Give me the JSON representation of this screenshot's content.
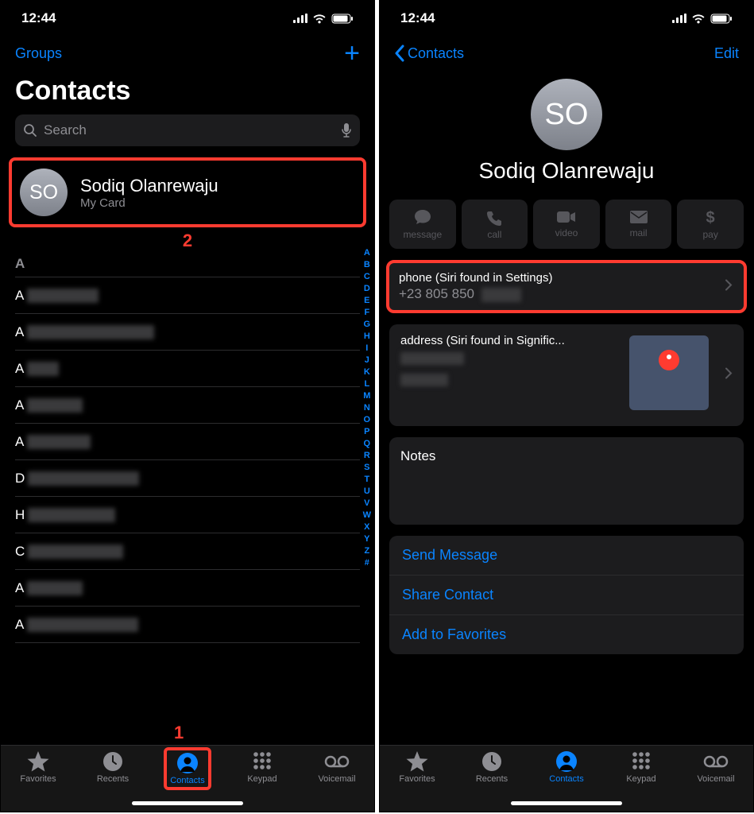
{
  "left": {
    "status": {
      "time": "12:44"
    },
    "nav": {
      "groups": "Groups"
    },
    "title": "Contacts",
    "search": {
      "placeholder": "Search"
    },
    "mycard": {
      "initials": "SO",
      "name": "Sodiq Olanrewaju",
      "sub": "My Card"
    },
    "annot2": "2",
    "section": "A",
    "rows": [
      {
        "prefix": "A",
        "bw": 90
      },
      {
        "prefix": "A",
        "bw": 160
      },
      {
        "prefix": "A",
        "bw": 40
      },
      {
        "prefix": "A",
        "bw": 70
      },
      {
        "prefix": "A",
        "bw": 80
      },
      {
        "prefix": "D",
        "bw": 140
      },
      {
        "prefix": "H",
        "bw": 110
      },
      {
        "prefix": "C",
        "bw": 120
      },
      {
        "prefix": "A",
        "bw": 70
      },
      {
        "prefix": "A",
        "bw": 140
      }
    ],
    "index": [
      "A",
      "B",
      "C",
      "D",
      "E",
      "F",
      "G",
      "H",
      "I",
      "J",
      "K",
      "L",
      "M",
      "N",
      "O",
      "P",
      "Q",
      "R",
      "S",
      "T",
      "U",
      "V",
      "W",
      "X",
      "Y",
      "Z",
      "#"
    ],
    "annot1": "1",
    "tabs": {
      "favorites": "Favorites",
      "recents": "Recents",
      "contacts": "Contacts",
      "keypad": "Keypad",
      "voicemail": "Voicemail"
    }
  },
  "right": {
    "status": {
      "time": "12:44"
    },
    "nav": {
      "back": "Contacts",
      "edit": "Edit"
    },
    "avatar": "SO",
    "name": "Sodiq Olanrewaju",
    "actions": {
      "message": "message",
      "call": "call",
      "video": "video",
      "mail": "mail",
      "pay": "pay"
    },
    "phone": {
      "label": "phone (Siri found in Settings)",
      "value": "+23   805 850"
    },
    "address": {
      "label": "address (Siri found in Signific..."
    },
    "notes": "Notes",
    "links": {
      "send": "Send Message",
      "share": "Share Contact",
      "fav": "Add to Favorites"
    },
    "tabs": {
      "favorites": "Favorites",
      "recents": "Recents",
      "contacts": "Contacts",
      "keypad": "Keypad",
      "voicemail": "Voicemail"
    }
  }
}
